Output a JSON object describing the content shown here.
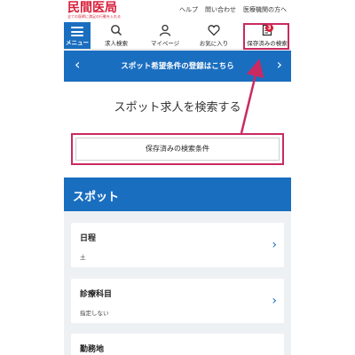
{
  "logo": {
    "main": "民間医局",
    "sub": "全ての医師に満足の行動を入れる"
  },
  "top_links": [
    "ヘルプ",
    "問い合わせ",
    "医療機関の方へ"
  ],
  "nav": {
    "menu_label": "メニュー",
    "items": [
      {
        "label": "求人検索",
        "icon": "search-icon"
      },
      {
        "label": "マイページ",
        "icon": "person-icon"
      },
      {
        "label": "お気に入り",
        "icon": "heart-icon"
      },
      {
        "label": "保存済みの検索",
        "icon": "document-icon",
        "badge": "3"
      }
    ]
  },
  "banner": {
    "text": "スポット希望条件の登録はこちら"
  },
  "search": {
    "title": "スポット求人を検索する",
    "saved_button": "保存済みの検索条件"
  },
  "spot": {
    "header": "スポット",
    "fields": [
      {
        "title": "日程",
        "value": "土"
      },
      {
        "title": "診療科目",
        "value": "指定しない"
      },
      {
        "title": "勤務地",
        "value": ""
      }
    ]
  },
  "colors": {
    "brand_blue": "#1a6ec0",
    "brand_red": "#d81e3a",
    "highlight": "#c92a62"
  }
}
